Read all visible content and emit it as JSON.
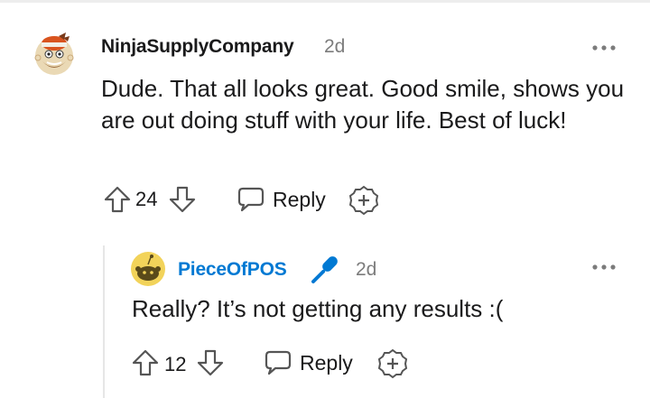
{
  "comment": {
    "username": "NinjaSupplyCompany",
    "time": "2d",
    "body": "Dude. That all looks great. Good smile, shows you are out doing stuff with your life. Best of luck!",
    "votes": "24",
    "reply_label": "Reply",
    "avatar_icon": "snoo-avatar-icon"
  },
  "reply": {
    "username": "PieceOfPOS",
    "flair_icon": "microphone-icon",
    "time": "2d",
    "body": "Really? It’s not getting any results :(",
    "votes": "12",
    "reply_label": "Reply",
    "username_color": "#0079d3",
    "avatar_color": "#f2d35a"
  }
}
